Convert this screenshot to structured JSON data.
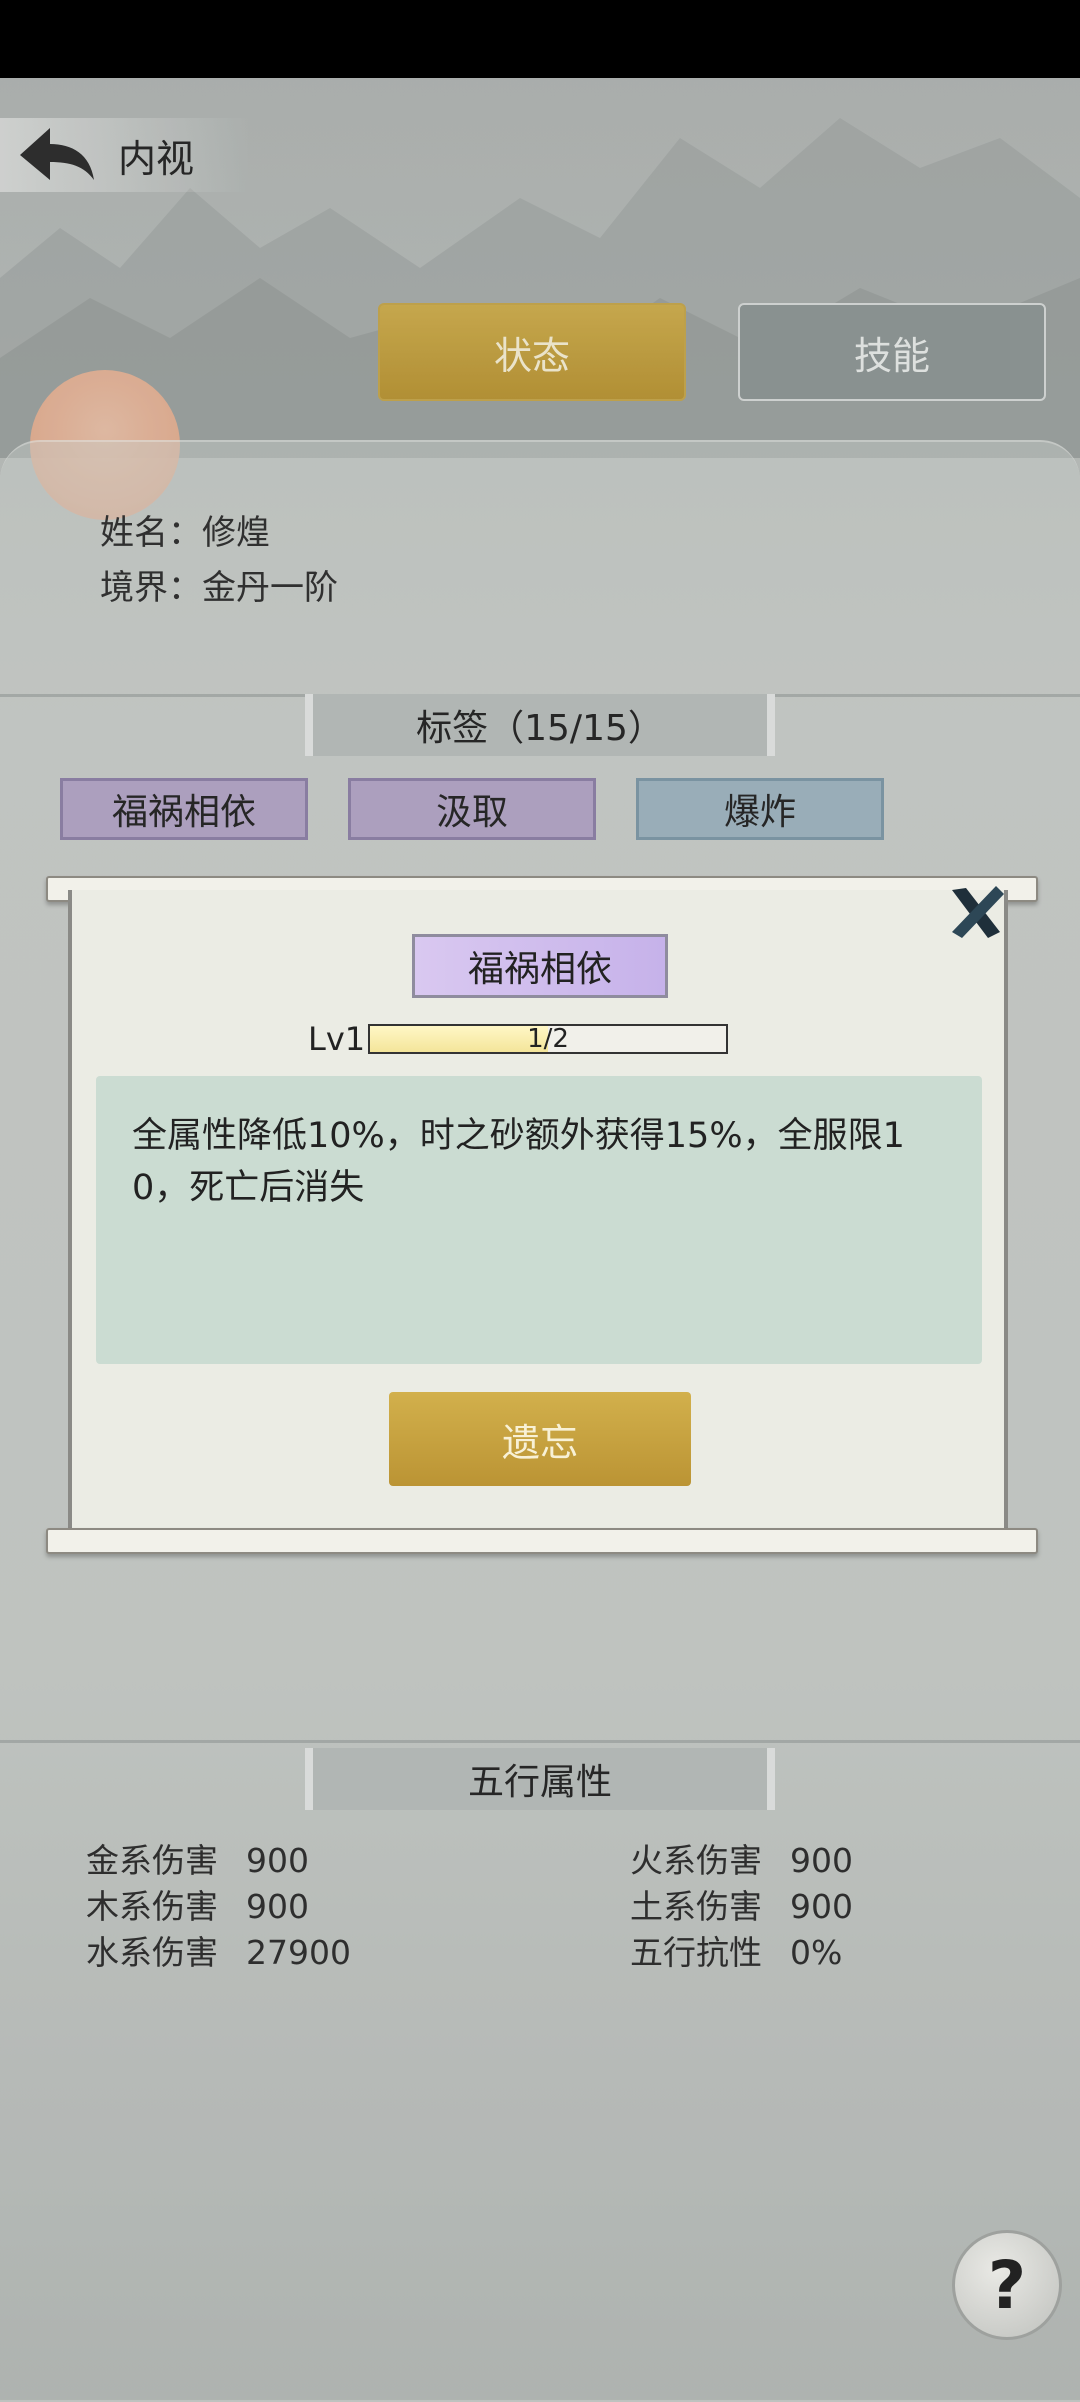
{
  "header": {
    "title": "内视"
  },
  "tabs": {
    "state": "状态",
    "skill": "技能"
  },
  "info": {
    "name": "姓名：修煌",
    "realm": "境界：金丹一阶"
  },
  "tags_section": {
    "title": "标签（15/15）",
    "tags": [
      "福祸相依",
      "汲取",
      "爆炸"
    ]
  },
  "dialog": {
    "tag_name": "福祸相依",
    "level_label": "Lv1",
    "progress_text": "1/2",
    "progress_fraction": 0.5,
    "description": "全属性降低10%，时之砂额外获得15%，全服限10，死亡后消失",
    "forget_label": "遗忘"
  },
  "elements_section": {
    "title": "五行属性",
    "left": [
      {
        "label": "金系伤害",
        "value": "900"
      },
      {
        "label": "木系伤害",
        "value": "900"
      },
      {
        "label": "水系伤害",
        "value": "27900"
      }
    ],
    "right": [
      {
        "label": "火系伤害",
        "value": "900"
      },
      {
        "label": "土系伤害",
        "value": "900"
      },
      {
        "label": "五行抗性",
        "value": "0%"
      }
    ]
  },
  "help": {
    "glyph": "?"
  }
}
